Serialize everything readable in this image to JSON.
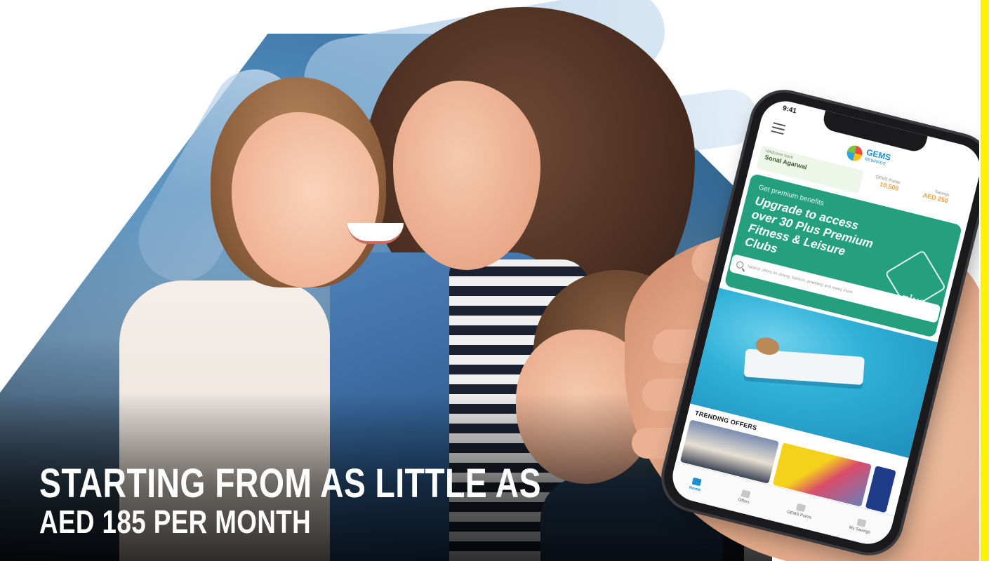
{
  "headline": {
    "line1": "STARTING FROM AS LITTLE AS",
    "line2": "AED 185 PER MONTH"
  },
  "phone": {
    "status_time": "9:41",
    "logo": {
      "name": "GEMS",
      "sub": "REWARDS",
      "icon": "gems-logo-icon"
    },
    "welcome": {
      "label": "Welcome back",
      "name": "Sonal Agarwal"
    },
    "stats": [
      {
        "label": "GEMS Points",
        "value": "10,500"
      },
      {
        "label": "Savings",
        "value": "AED 250"
      }
    ],
    "promo": {
      "kicker": "Get premium benefits",
      "title": "Upgrade to access over 30 Plus Premium Fitness & Leisure Clubs",
      "badge": "plus",
      "bg_color": "#25a07e"
    },
    "search": {
      "placeholder": "Search offers on dining, fashion, jewellery and many more"
    },
    "section_title": "TRENDING OFFERS",
    "tabs": [
      {
        "label": "Home",
        "active": true,
        "icon": "home-icon"
      },
      {
        "label": "Offers",
        "active": false,
        "icon": "offers-icon"
      },
      {
        "label": "GEMS Points",
        "active": false,
        "icon": "points-icon"
      },
      {
        "label": "My Savings",
        "active": false,
        "icon": "savings-icon"
      }
    ]
  },
  "colors": {
    "frame": "#fff200",
    "brand_blue": "#1b8fd0",
    "promo_green": "#25a07e"
  }
}
